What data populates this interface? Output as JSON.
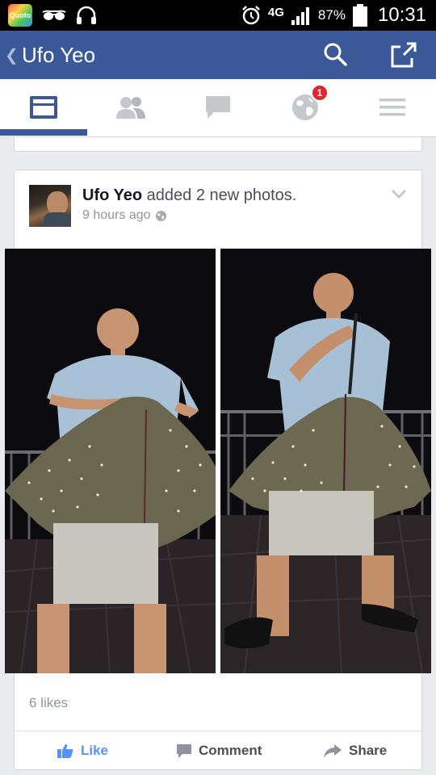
{
  "status_bar": {
    "app_badge": "Quoto",
    "network": "4G",
    "battery": "87%",
    "time": "10:31"
  },
  "header": {
    "title": "Ufo Yeo",
    "icons": [
      "back-chevron-icon",
      "search-icon",
      "share-icon"
    ]
  },
  "tabs": [
    {
      "name": "news-feed",
      "icon": "news-feed-icon",
      "active": true
    },
    {
      "name": "friend-requests",
      "icon": "friends-icon"
    },
    {
      "name": "messages",
      "icon": "messages-icon"
    },
    {
      "name": "notifications",
      "icon": "globe-icon",
      "badge": "1"
    },
    {
      "name": "more",
      "icon": "menu-icon"
    }
  ],
  "post": {
    "author": "Ufo Yeo",
    "action": "added 2 new photos.",
    "time": "9 hours ago",
    "audience_icon": "globe-icon",
    "photos": [
      "photo-1",
      "photo-2"
    ],
    "likes": "6 likes",
    "actions": {
      "like": "Like",
      "comment": "Comment",
      "share": "Share"
    }
  },
  "colors": {
    "brand": "#3b5998",
    "like_blue": "#5890ff",
    "badge_red": "#e3262e"
  }
}
